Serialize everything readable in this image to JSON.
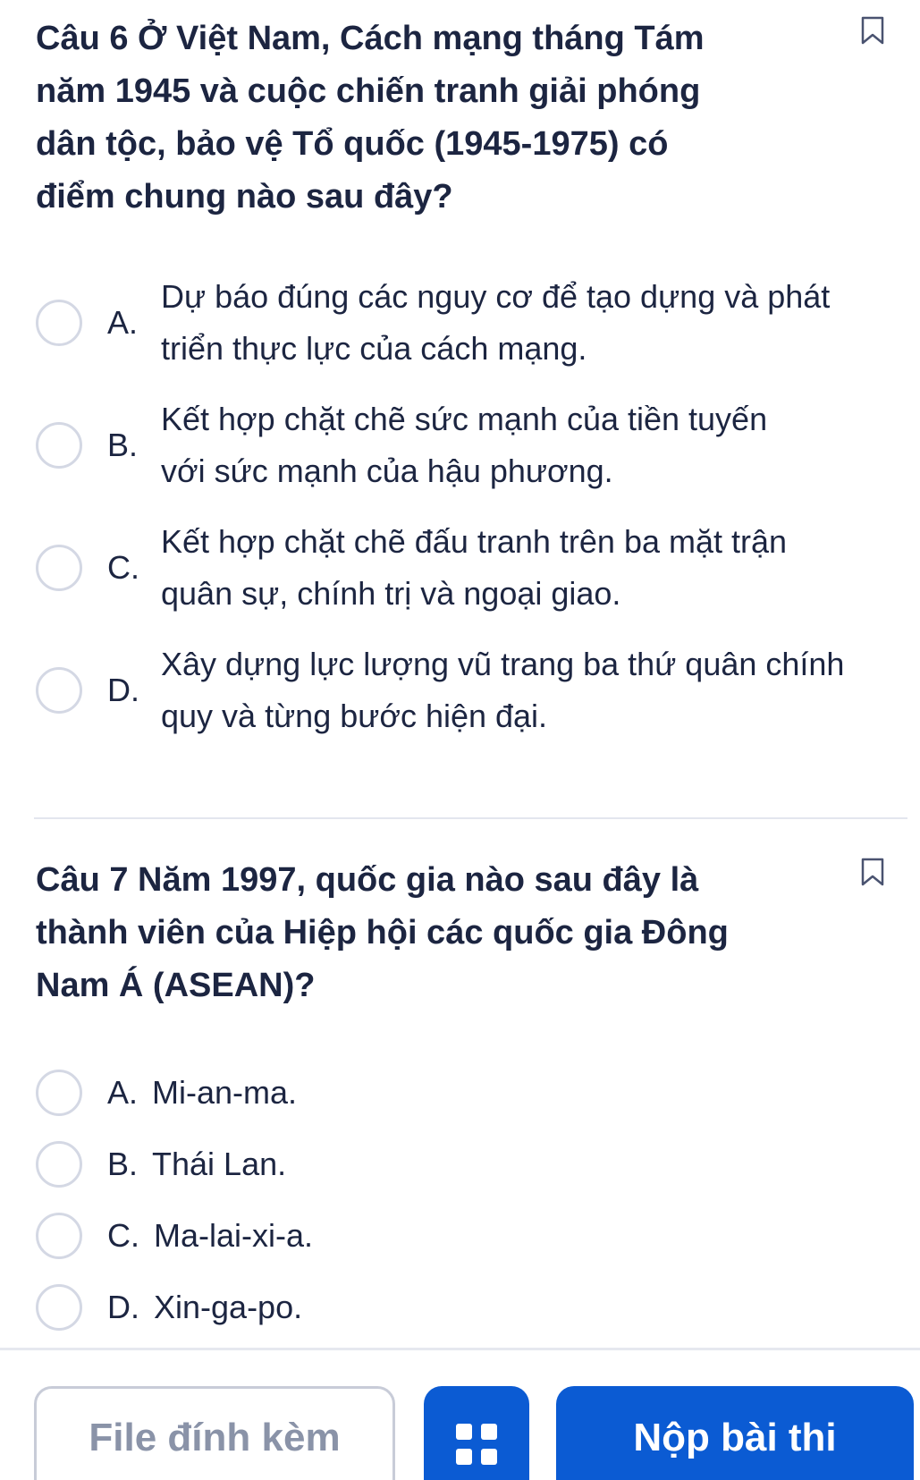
{
  "questions": [
    {
      "title": "Câu 6  Ở Việt Nam, Cách mạng tháng Tám năm 1945 và cuộc chiến tranh giải phóng dân tộc, bảo vệ Tổ quốc (1945-1975) có điểm chung nào sau đây?",
      "bookmark_icon": "bookmark-icon",
      "options": [
        {
          "letter": "A.",
          "text": "Dự báo đúng các nguy cơ để tạo dựng và phát triển thực lực của cách mạng."
        },
        {
          "letter": "B.",
          "text": "Kết hợp chặt chẽ sức mạnh của tiền tuyến với sức mạnh của hậu phương."
        },
        {
          "letter": "C.",
          "text": "Kết hợp chặt chẽ đấu tranh trên ba mặt trận quân sự, chính trị và ngoại giao."
        },
        {
          "letter": "D.",
          "text": "Xây dựng lực lượng vũ trang ba thứ quân chính quy và từng bước hiện đại."
        }
      ]
    },
    {
      "title": "Câu 7  Năm 1997, quốc gia nào sau đây là thành viên của Hiệp hội các quốc gia Đông Nam Á (ASEAN)?",
      "bookmark_icon": "bookmark-icon",
      "options": [
        {
          "letter": "A.",
          "text": "Mi-an-ma."
        },
        {
          "letter": "B.",
          "text": "Thái Lan."
        },
        {
          "letter": "C.",
          "text": "Ma-lai-xi-a."
        },
        {
          "letter": "D.",
          "text": "Xin-ga-po."
        }
      ]
    }
  ],
  "footer": {
    "attach_label": "File đính kèm",
    "grid_icon": "grid-icon",
    "submit_label": "Nộp bài thi",
    "accent_color": "#0b5bd3"
  }
}
